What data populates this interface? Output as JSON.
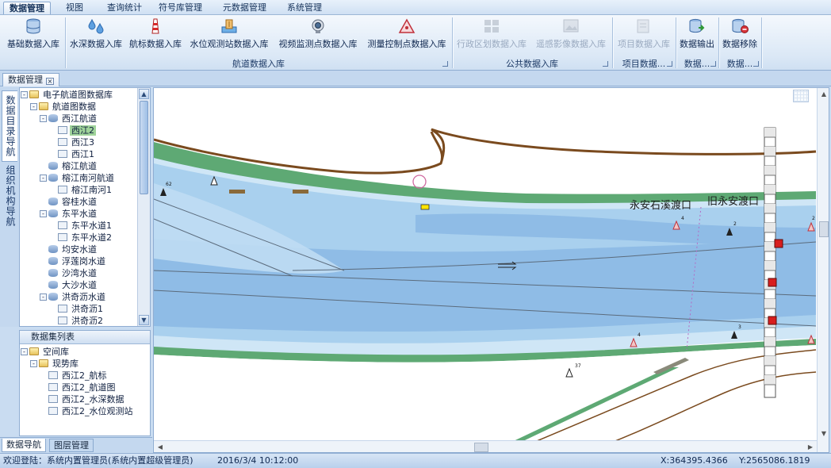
{
  "menu": {
    "items": [
      "数据管理",
      "视图",
      "查询统计",
      "符号库管理",
      "元数据管理",
      "系统管理"
    ]
  },
  "ribbon": {
    "buttons": [
      {
        "label": "基础数据入库",
        "icon": "database-icon",
        "enabled": true
      },
      {
        "label": "水深数据入库",
        "icon": "water-drops-icon",
        "enabled": true
      },
      {
        "label": "航标数据入库",
        "icon": "lighthouse-icon",
        "enabled": true
      },
      {
        "label": "水位观测站数据入库",
        "icon": "gauge-station-icon",
        "enabled": true
      },
      {
        "label": "视频监测点数据入库",
        "icon": "camera-icon",
        "enabled": true
      },
      {
        "label": "测量控制点数据入库",
        "icon": "triangle-point-icon",
        "enabled": true
      },
      {
        "label": "行政区划数据入库",
        "icon": "region-grid-icon",
        "enabled": false
      },
      {
        "label": "遥感影像数据入库",
        "icon": "image-icon",
        "enabled": false
      },
      {
        "label": "项目数据入库",
        "icon": "project-icon",
        "enabled": false
      },
      {
        "label": "数据输出",
        "icon": "database-export-icon",
        "enabled": true
      },
      {
        "label": "数据移除",
        "icon": "database-remove-icon",
        "enabled": true
      }
    ],
    "groups": [
      "航道数据入库",
      "公共数据入库",
      "项目数据...",
      "数据...",
      "数据..."
    ]
  },
  "doc_tab": {
    "label": "数据管理"
  },
  "left_vertical_tabs": [
    "数据目录导航",
    "组织机构导航"
  ],
  "catalog_tree": [
    {
      "label": "电子航道图数据库",
      "level": 0,
      "icon": "folder",
      "toggle": "-"
    },
    {
      "label": "航道图数据",
      "level": 1,
      "icon": "folder",
      "toggle": "-"
    },
    {
      "label": "西江航道",
      "level": 2,
      "icon": "db",
      "toggle": "-"
    },
    {
      "label": "西江2",
      "level": 3,
      "icon": "layer",
      "toggle": "",
      "selected": true
    },
    {
      "label": "西江3",
      "level": 3,
      "icon": "layer",
      "toggle": ""
    },
    {
      "label": "西江1",
      "level": 3,
      "icon": "layer",
      "toggle": ""
    },
    {
      "label": "榕江航道",
      "level": 2,
      "icon": "db",
      "toggle": ""
    },
    {
      "label": "榕江南河航道",
      "level": 2,
      "icon": "db",
      "toggle": "-"
    },
    {
      "label": "榕江南河1",
      "level": 3,
      "icon": "layer",
      "toggle": ""
    },
    {
      "label": "容桂水道",
      "level": 2,
      "icon": "db",
      "toggle": ""
    },
    {
      "label": "东平水道",
      "level": 2,
      "icon": "db",
      "toggle": "-"
    },
    {
      "label": "东平水道1",
      "level": 3,
      "icon": "layer",
      "toggle": ""
    },
    {
      "label": "东平水道2",
      "level": 3,
      "icon": "layer",
      "toggle": ""
    },
    {
      "label": "均安水道",
      "level": 2,
      "icon": "db",
      "toggle": ""
    },
    {
      "label": "浮莲岗水道",
      "level": 2,
      "icon": "db",
      "toggle": ""
    },
    {
      "label": "沙湾水道",
      "level": 2,
      "icon": "db",
      "toggle": ""
    },
    {
      "label": "大沙水道",
      "level": 2,
      "icon": "db",
      "toggle": ""
    },
    {
      "label": "洪奇沥水道",
      "level": 2,
      "icon": "db",
      "toggle": "-"
    },
    {
      "label": "洪奇沥1",
      "level": 3,
      "icon": "layer",
      "toggle": ""
    },
    {
      "label": "洪奇沥2",
      "level": 3,
      "icon": "layer",
      "toggle": ""
    }
  ],
  "dataset_panel": {
    "title": "数据集列表",
    "items": [
      {
        "label": "空间库",
        "level": 0,
        "icon": "folder",
        "toggle": "-"
      },
      {
        "label": "现势库",
        "level": 1,
        "icon": "folder",
        "toggle": "-"
      },
      {
        "label": "西江2_航标",
        "level": 2,
        "icon": "layer",
        "toggle": ""
      },
      {
        "label": "西江2_航道图",
        "level": 2,
        "icon": "layer",
        "toggle": ""
      },
      {
        "label": "西江2_水深数据",
        "level": 2,
        "icon": "layer",
        "toggle": ""
      },
      {
        "label": "西江2_水位观测站",
        "level": 2,
        "icon": "layer",
        "toggle": ""
      }
    ]
  },
  "bottom_tabs": [
    "数据导航",
    "图层管理"
  ],
  "map": {
    "labels": [
      "永安石溪渡口",
      "旧永安渡口"
    ],
    "buoy_numbers": [
      "62",
      "4",
      "2",
      "3",
      "4",
      "37",
      "2"
    ],
    "colors": {
      "deep_water": "#8fbce6",
      "mid_water": "#a9d0ee",
      "shallow_water": "#cfe6f6",
      "shore_green": "#5ea974",
      "bank_brown": "#7a4a1e",
      "marker_red": "#d81e1e"
    }
  },
  "status": {
    "welcome": "欢迎登陆：系统内置管理员(系统内置超级管理员)",
    "datetime": "2016/3/4 10:12:00",
    "x_coord": "X:364395.4366",
    "y_coord": "Y:2565086.1819"
  }
}
